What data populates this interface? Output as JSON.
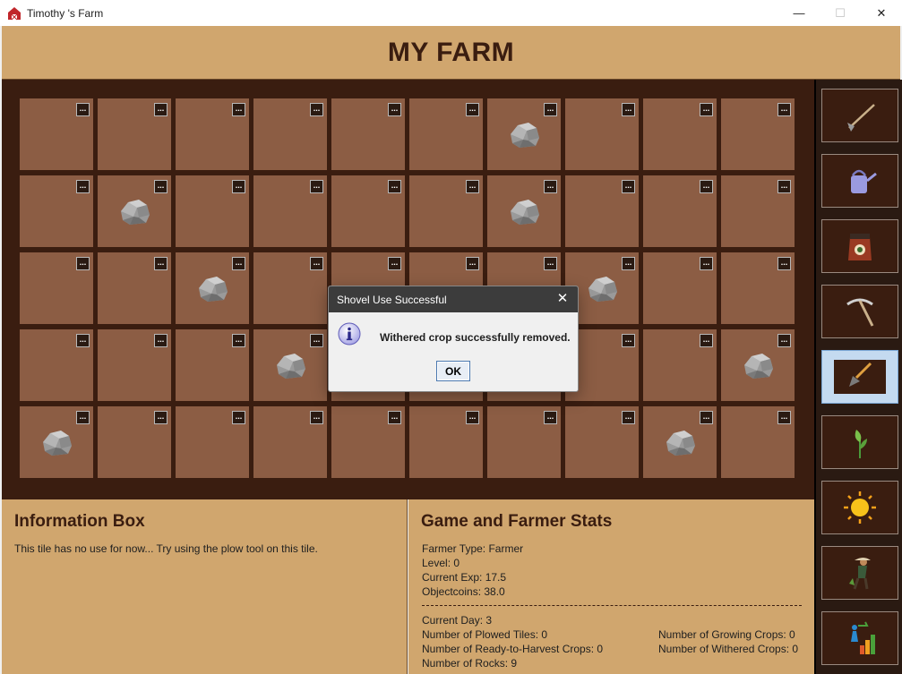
{
  "window": {
    "title": "Timothy 's Farm",
    "minimize": "—",
    "maximize": "☐",
    "close": "✕"
  },
  "header": {
    "title": "MY FARM"
  },
  "farm": {
    "tile_button_label": "...",
    "rows": 5,
    "cols": 10,
    "rock_tiles": [
      [
        0,
        6
      ],
      [
        1,
        1
      ],
      [
        1,
        6
      ],
      [
        2,
        2
      ],
      [
        2,
        7
      ],
      [
        3,
        3
      ],
      [
        3,
        9
      ],
      [
        4,
        0
      ],
      [
        4,
        8
      ]
    ]
  },
  "tools": [
    {
      "name": "plow-tool",
      "icon": "hoe-icon",
      "active": false
    },
    {
      "name": "watering-can-tool",
      "icon": "watering-can-icon",
      "active": false
    },
    {
      "name": "fertilizer-tool",
      "icon": "fertilizer-bag-icon",
      "active": false
    },
    {
      "name": "pickaxe-tool",
      "icon": "pickaxe-icon",
      "active": false
    },
    {
      "name": "shovel-tool",
      "icon": "shovel-icon",
      "active": true
    },
    {
      "name": "plant-seed-tool",
      "icon": "sprout-icon",
      "active": false
    },
    {
      "name": "advance-day-tool",
      "icon": "sun-icon",
      "active": false
    },
    {
      "name": "harvest-tool",
      "icon": "farmer-harvest-icon",
      "active": false
    },
    {
      "name": "register-tool",
      "icon": "level-up-icon",
      "active": false
    }
  ],
  "info_box": {
    "title": "Information Box",
    "text": "This tile has no use for now... Try using the plow tool on this tile."
  },
  "stats": {
    "title": "Game and Farmer Stats",
    "farmer_type": "Farmer Type: Farmer",
    "level": "Level: 0",
    "current_exp": "Current Exp: 17.5",
    "objectcoins": "Objectcoins: 38.0",
    "current_day": "Current Day: 3",
    "plowed_tiles": "Number of Plowed Tiles: 0",
    "ready_crops": "Number of Ready-to-Harvest Crops: 0",
    "rocks": "Number of Rocks: 9",
    "growing_crops": "Number of Growing Crops: 0",
    "withered_crops": "Number of Withered Crops: 0"
  },
  "dialog": {
    "title": "Shovel Use Successful",
    "message": "Withered crop successfully removed.",
    "ok_label": "OK",
    "close": "✕"
  },
  "colors": {
    "panel": "#d0a66e",
    "soil": "#8c5d44",
    "dark_brown": "#3a1d10"
  }
}
